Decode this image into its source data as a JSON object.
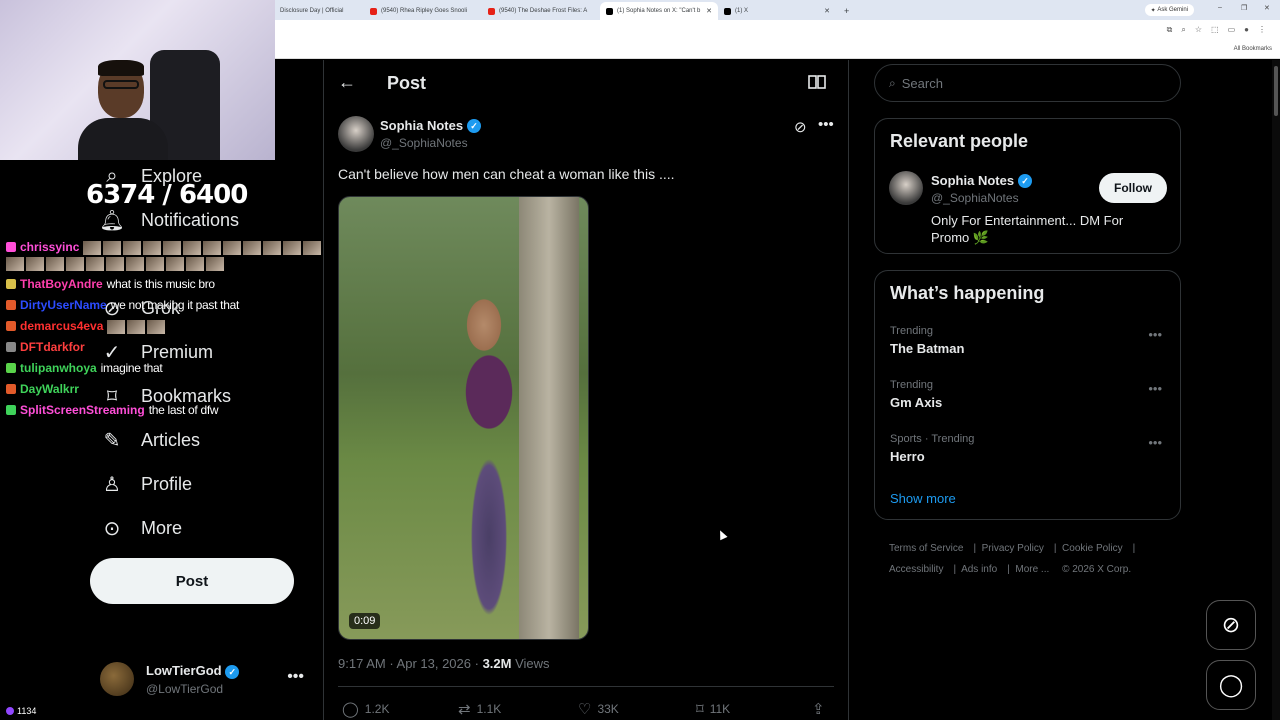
{
  "browser": {
    "tabs": [
      {
        "label": "Disclosure Day | Official"
      },
      {
        "label": "(9540) Rhea Ripley Goes Snooli"
      },
      {
        "label": "(9540) The Deshae Frost Files: A"
      },
      {
        "label": "(1) Sophia Notes on X: \"Can't b"
      },
      {
        "label": "(1) X"
      }
    ],
    "ask_gemini": "Ask Gemini",
    "all_bookmarks": "All Bookmarks"
  },
  "stream": {
    "counter": "6374 / 6400",
    "viewer_count": "1134",
    "chat": [
      {
        "user": "chrissyinc",
        "color": "#ff4fd8",
        "message": ""
      },
      {
        "user": "ThatBoyAndre",
        "color": "#ff3fae",
        "message": "what is this music bro"
      },
      {
        "user": "DirtyUserName",
        "color": "#2c4cff",
        "message": "we not making it past that"
      },
      {
        "user": "demarcus4eva",
        "color": "#ff3030",
        "message": ""
      },
      {
        "user": "DFTdarkfor",
        "color": "#ff3f3f",
        "message": ""
      },
      {
        "user": "tulipanwhoya",
        "color": "#3fd35a",
        "message": "imagine that"
      },
      {
        "user": "DayWalkrr",
        "color": "#3fd35a",
        "message": ""
      },
      {
        "user": "SplitScreenStreaming",
        "color": "#ff4fd8",
        "message": "the last of dfw"
      }
    ]
  },
  "nav": {
    "items": [
      {
        "label": "Explore",
        "icon": "search-icon"
      },
      {
        "label": "Notifications",
        "icon": "bell-icon"
      },
      {
        "label": "Grok",
        "icon": "grok-icon"
      },
      {
        "label": "Premium",
        "icon": "premium-icon"
      },
      {
        "label": "Bookmarks",
        "icon": "bookmark-icon"
      },
      {
        "label": "Articles",
        "icon": "article-icon"
      },
      {
        "label": "Profile",
        "icon": "person-icon"
      },
      {
        "label": "More",
        "icon": "more-circle-icon"
      }
    ],
    "post_button": "Post",
    "account": {
      "name": "LowTierGod",
      "handle": "@LowTierGod"
    }
  },
  "post": {
    "header_title": "Post",
    "author_name": "Sophia Notes",
    "author_handle": "@_SophiaNotes",
    "text": "Can't believe how men can cheat a woman like this ....",
    "video_duration": "0:09",
    "time": "9:17 AM",
    "date": "Apr 13, 2026",
    "views_count": "3.2M",
    "views_label": "Views",
    "actions": {
      "replies": "1.2K",
      "reposts": "1.1K",
      "likes": "33K",
      "bookmarks": "11K"
    }
  },
  "sidebar": {
    "search_placeholder": "Search",
    "relevant_people": {
      "title": "Relevant people",
      "name": "Sophia Notes",
      "handle": "@_SophiaNotes",
      "bio": "Only For Entertainment... DM For Promo 🌿",
      "follow_label": "Follow"
    },
    "whats_happening": {
      "title": "What’s happening",
      "trends": [
        {
          "category": "Trending",
          "topic": "The Batman"
        },
        {
          "category": "Trending",
          "topic": "Gm Axis"
        },
        {
          "category": "Sports · Trending",
          "topic": "Herro"
        }
      ],
      "show_more": "Show more"
    },
    "footer": {
      "terms": "Terms of Service",
      "privacy": "Privacy Policy",
      "cookie": "Cookie Policy",
      "accessibility": "Accessibility",
      "ads": "Ads info",
      "more": "More ...",
      "copyright": "© 2026 X Corp."
    }
  }
}
